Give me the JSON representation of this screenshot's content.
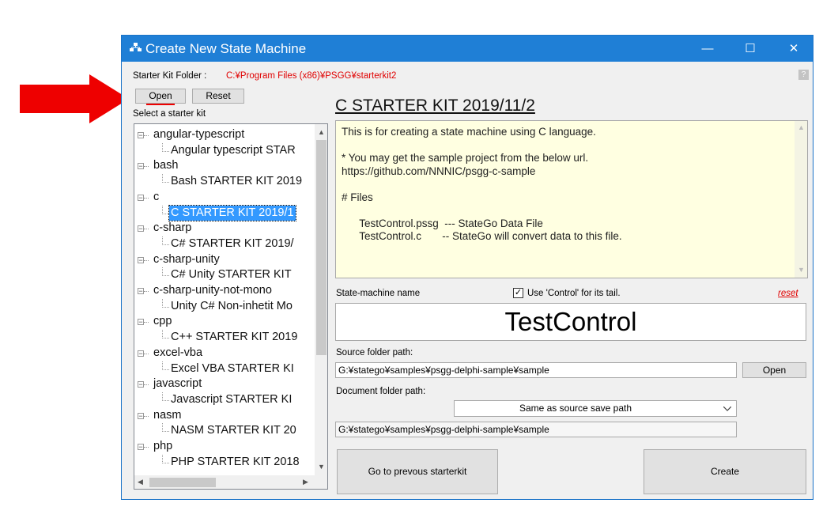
{
  "window": {
    "title": "Create New State Machine",
    "minimize_glyph": "—",
    "maximize_glyph": "☐",
    "close_glyph": "✕",
    "help_glyph": "?"
  },
  "starter_kit_folder": {
    "label": "Starter Kit Folder :",
    "path": "C:¥Program Files (x86)¥PSGG¥starterkit2"
  },
  "buttons": {
    "open": "Open",
    "reset": "Reset",
    "source_open": "Open",
    "go_previous": "Go to prevous starterkit",
    "create": "Create"
  },
  "list": {
    "label": "Select a starter kit",
    "items": [
      {
        "text": "angular-typescript",
        "level": 0
      },
      {
        "text": "Angular typescript STAR",
        "level": 1
      },
      {
        "text": "bash",
        "level": 0
      },
      {
        "text": "Bash STARTER KIT 2019",
        "level": 1
      },
      {
        "text": "c",
        "level": 0
      },
      {
        "text": "C STARTER KIT 2019/1",
        "level": 1,
        "selected": true
      },
      {
        "text": "c-sharp",
        "level": 0
      },
      {
        "text": "C# STARTER KIT 2019/",
        "level": 1
      },
      {
        "text": "c-sharp-unity",
        "level": 0
      },
      {
        "text": "C# Unity STARTER KIT",
        "level": 1
      },
      {
        "text": "c-sharp-unity-not-mono",
        "level": 0
      },
      {
        "text": "Unity C# Non-inhetit Mo",
        "level": 1
      },
      {
        "text": "cpp",
        "level": 0
      },
      {
        "text": "C++ STARTER KIT 2019",
        "level": 1
      },
      {
        "text": "excel-vba",
        "level": 0
      },
      {
        "text": "Excel VBA STARTER KI",
        "level": 1
      },
      {
        "text": "javascript",
        "level": 0
      },
      {
        "text": "Javascript STARTER KI",
        "level": 1
      },
      {
        "text": "nasm",
        "level": 0
      },
      {
        "text": "NASM STARTER KIT 20",
        "level": 1
      },
      {
        "text": "php",
        "level": 0
      },
      {
        "text": "PHP STARTER KIT 2018",
        "level": 1
      }
    ]
  },
  "kit": {
    "title": "C STARTER KIT 2019/11/2",
    "description": [
      "This is for creating a state machine using C language.",
      "",
      "* You may get the sample project from the below url.",
      "https://github.com/NNNIC/psgg-c-sample",
      "",
      "# Files",
      "",
      "      TestControl.pssg  --- StateGo Data File",
      "      TestControl.c       -- StateGo will convert data to this file."
    ]
  },
  "state_machine": {
    "label": "State-machine name",
    "use_control_label": "Use 'Control' for its tail.",
    "use_control_checked": true,
    "reset_link": "reset",
    "name": "TestControl"
  },
  "source_folder": {
    "label": "Source folder path:",
    "path": "G:¥stateg‌o¥samples¥psgg-delphi-sample¥sample"
  },
  "document_folder": {
    "label": "Document folder path:",
    "option": "Same as source save path",
    "path": "G:¥stateg‌o¥samples¥psgg-delphi-sample¥sample"
  },
  "colors": {
    "titlebar": "#1f7fd6",
    "arrow": "#ee0000",
    "selection": "#3399ff",
    "description_bg": "#ffffe1",
    "folder_path": "#e00000"
  }
}
